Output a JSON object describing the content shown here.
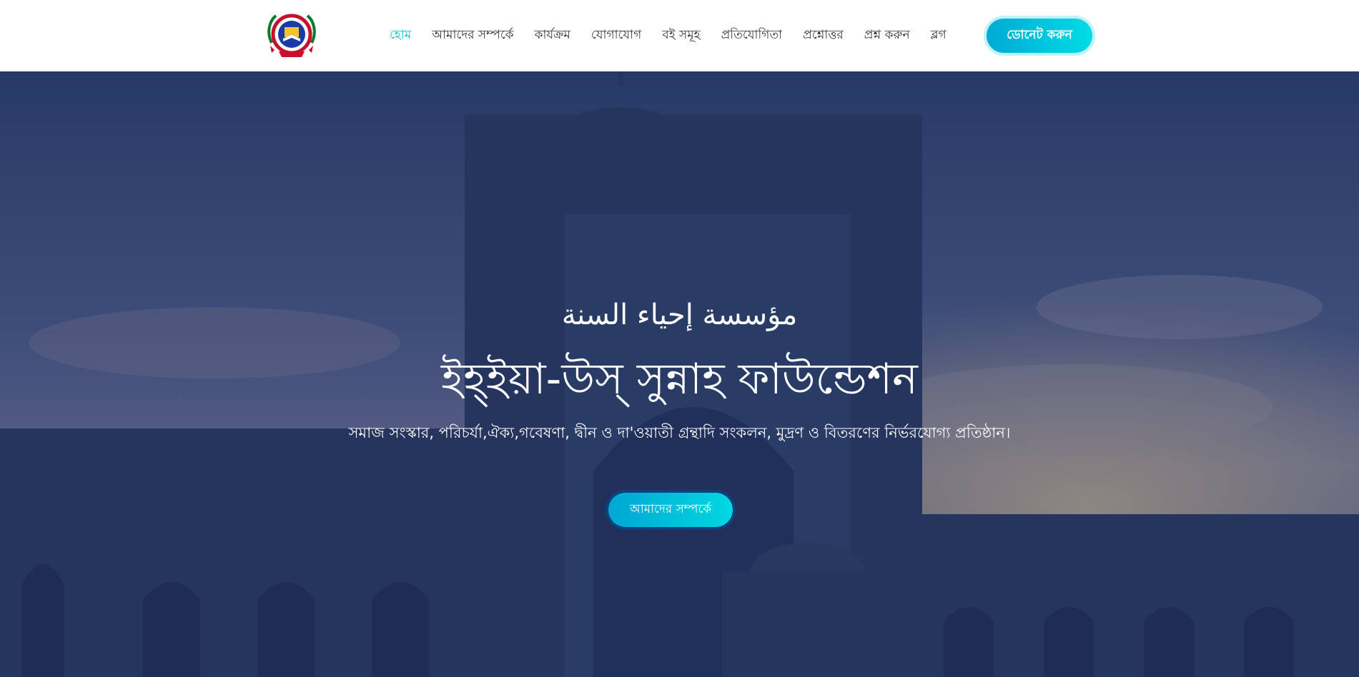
{
  "header": {
    "logo_icon": "organization-emblem-icon",
    "nav": [
      {
        "label": "হোম",
        "active": true
      },
      {
        "label": "আমাদের সম্পর্কে",
        "active": false
      },
      {
        "label": "কার্যক্রম",
        "active": false
      },
      {
        "label": "যোগাযোগ",
        "active": false
      },
      {
        "label": "বই সমূহ",
        "active": false
      },
      {
        "label": "প্রতিযোগিতা",
        "active": false
      },
      {
        "label": "প্রশ্নোত্তর",
        "active": false
      },
      {
        "label": "প্রশ্ন করুন",
        "active": false
      },
      {
        "label": "ব্লগ",
        "active": false
      }
    ],
    "donate_label": "ডোনেট করুন"
  },
  "hero": {
    "background": "mosque-at-dusk-image",
    "arabic_title": "مؤسسة إحياء السنة",
    "title": "ইহ্ইয়া-উস্ সুন্নাহ ফাউন্ডেশন",
    "subtitle": "সমাজ সংস্কার, পরিচর্যা,ঐক্য,গবেষণা, দ্বীন ও দা'ওয়াতী গ্রন্থাদি সংকলন, মুদ্রণ ও বিতরণের নির্ভরযোগ্য প্রতিষ্ঠান।",
    "cta_label": "আমাদের সম্পর্কে"
  },
  "colors": {
    "accent": "#00c4d6",
    "nav_text": "#333333",
    "hero_overlay": "#1e2d5a",
    "white": "#ffffff"
  }
}
